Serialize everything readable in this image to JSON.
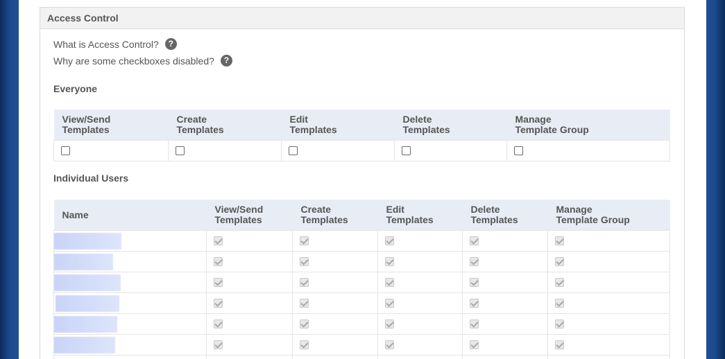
{
  "panel": {
    "title": "Access Control"
  },
  "help": [
    {
      "text": "What is Access Control?",
      "icon": "question-circle-icon"
    },
    {
      "text": "Why are some checkboxes disabled?",
      "icon": "question-circle-icon"
    }
  ],
  "everyone": {
    "title": "Everyone",
    "columns": [
      [
        "View/Send",
        "Templates"
      ],
      [
        "Create",
        "Templates"
      ],
      [
        "Edit",
        "Templates"
      ],
      [
        "Delete",
        "Templates"
      ],
      [
        "Manage",
        "Template Group"
      ]
    ],
    "checked": [
      false,
      false,
      false,
      false,
      false
    ]
  },
  "individual": {
    "title": "Individual Users",
    "name_header": "Name",
    "columns": [
      [
        "View/Send",
        "Templates"
      ],
      [
        "Create",
        "Templates"
      ],
      [
        "Edit",
        "Templates"
      ],
      [
        "Delete",
        "Templates"
      ],
      [
        "Manage",
        "Template Group"
      ]
    ],
    "rows": [
      {
        "name": "",
        "checked": [
          true,
          true,
          true,
          true,
          true
        ]
      },
      {
        "name": "",
        "checked": [
          true,
          true,
          true,
          true,
          true
        ]
      },
      {
        "name": "",
        "checked": [
          true,
          true,
          true,
          true,
          true
        ]
      },
      {
        "name": "",
        "checked": [
          true,
          true,
          true,
          true,
          true
        ]
      },
      {
        "name": "",
        "checked": [
          true,
          true,
          true,
          true,
          true
        ]
      },
      {
        "name": "",
        "checked": [
          true,
          true,
          true,
          true,
          true
        ]
      }
    ]
  },
  "colors": {
    "header_bg": "#e8edf5",
    "page_bg": "#1c4a8e",
    "redaction": "#c9d4f7"
  }
}
